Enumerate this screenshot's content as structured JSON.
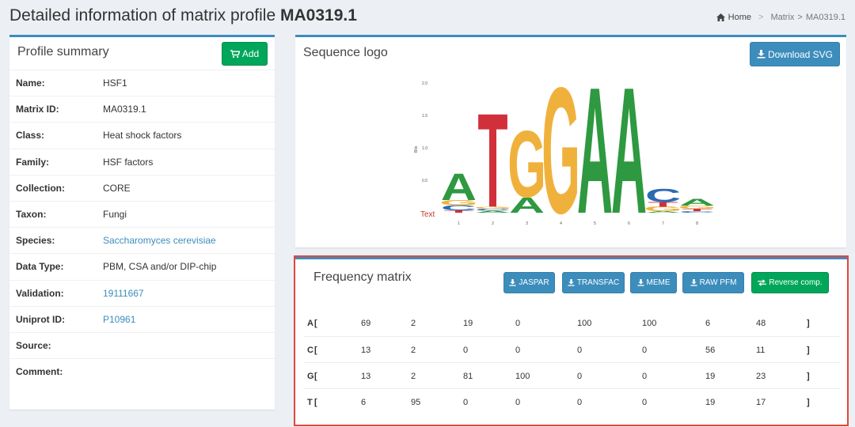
{
  "header": {
    "title_prefix": "Detailed information of matrix profile",
    "title_id": "MA0319.1",
    "breadcrumb": {
      "home": "Home",
      "matrix": "Matrix",
      "sep": ">",
      "current": "MA0319.1"
    }
  },
  "summary": {
    "title": "Profile summary",
    "add_label": "Add",
    "rows": [
      {
        "label": "Name:",
        "value": "HSF1"
      },
      {
        "label": "Matrix ID:",
        "value": "MA0319.1"
      },
      {
        "label": "Class:",
        "value": "Heat shock factors"
      },
      {
        "label": "Family:",
        "value": "HSF factors"
      },
      {
        "label": "Collection:",
        "value": "CORE"
      },
      {
        "label": "Taxon:",
        "value": "Fungi"
      },
      {
        "label": "Species:",
        "value": "Saccharomyces cerevisiae"
      },
      {
        "label": "Data Type:",
        "value": "PBM, CSA and/or DIP-chip"
      },
      {
        "label": "Validation:",
        "value": "19111667"
      },
      {
        "label": "Uniprot ID:",
        "value": "P10961"
      },
      {
        "label": "Source:",
        "value": ""
      },
      {
        "label": "Comment:",
        "value": ""
      }
    ]
  },
  "logo": {
    "title": "Sequence logo",
    "download_label": "Download SVG",
    "y_axis_label": "Bits",
    "y_ticks": [
      "2.0",
      "1.5",
      "1.0",
      "0.5"
    ],
    "x_ticks": [
      "1",
      "2",
      "3",
      "4",
      "5",
      "6",
      "7",
      "8"
    ],
    "watermark": "Text",
    "colors": {
      "A": "#2e9940",
      "C": "#2c6bb3",
      "G": "#f0b13c",
      "T": "#d1303a"
    }
  },
  "frequency": {
    "title": "Frequency matrix",
    "buttons": [
      "JASPAR",
      "TRANSFAC",
      "MEME",
      "RAW PFM",
      "Reverse comp."
    ],
    "open_suffix": "[",
    "close": "]",
    "rows": [
      {
        "base": "A",
        "values": [
          69,
          2,
          19,
          0,
          100,
          100,
          6,
          48
        ]
      },
      {
        "base": "C",
        "values": [
          13,
          2,
          0,
          0,
          0,
          0,
          56,
          11
        ]
      },
      {
        "base": "G",
        "values": [
          13,
          2,
          81,
          100,
          0,
          0,
          19,
          23
        ]
      },
      {
        "base": "T",
        "values": [
          6,
          95,
          0,
          0,
          0,
          0,
          19,
          17
        ]
      }
    ]
  }
}
